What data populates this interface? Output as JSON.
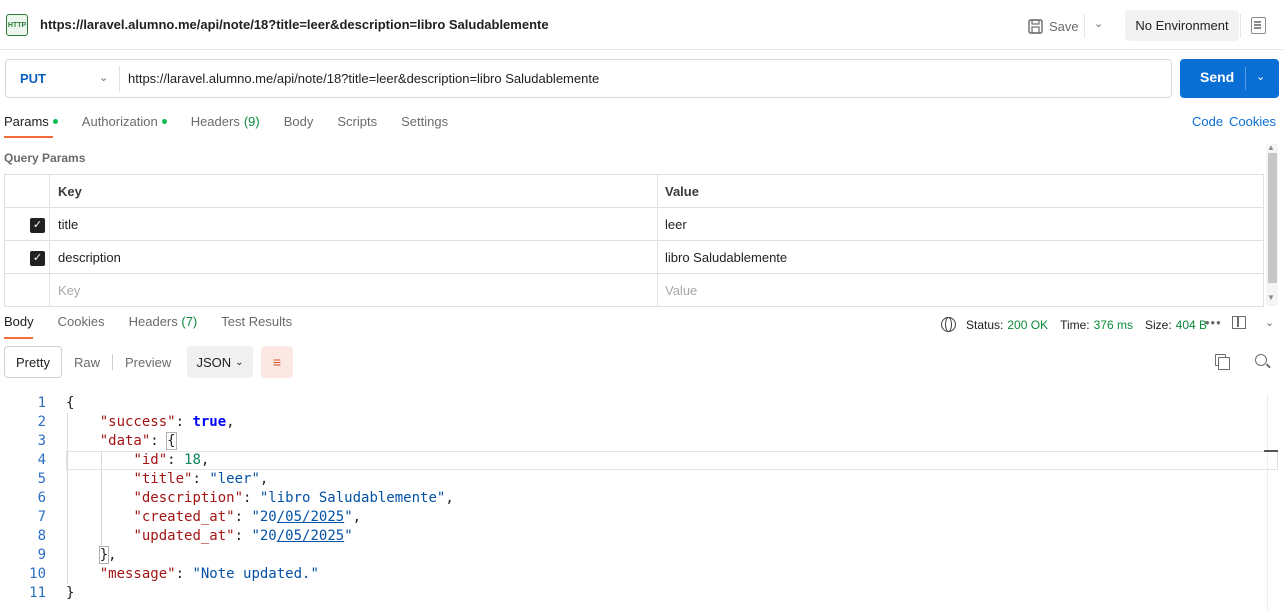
{
  "titlebar": {
    "icon_text": "HTTP",
    "title": "https://laravel.alumno.me/api/note/18?title=leer&description=libro Saludablemente",
    "save_label": "Save",
    "environment": "No Environment"
  },
  "request": {
    "method": "PUT",
    "url": "https://laravel.alumno.me/api/note/18?title=leer&description=libro Saludablemente",
    "send_label": "Send"
  },
  "request_tabs": {
    "params": "Params",
    "authorization": "Authorization",
    "headers": "Headers",
    "headers_count": "(9)",
    "body": "Body",
    "scripts": "Scripts",
    "settings": "Settings",
    "code_link": "Code",
    "cookies_link": "Cookies"
  },
  "query_params": {
    "title": "Query Params",
    "header_key": "Key",
    "header_value": "Value",
    "rows": [
      {
        "key": "title",
        "value": "leer",
        "checked": true
      },
      {
        "key": "description",
        "value": "libro Saludablemente",
        "checked": true
      }
    ],
    "placeholder_key": "Key",
    "placeholder_value": "Value"
  },
  "response_tabs": {
    "body": "Body",
    "cookies": "Cookies",
    "headers": "Headers",
    "headers_count": "(7)",
    "test_results": "Test Results"
  },
  "response_status": {
    "status_label": "Status:",
    "status_value": "200 OK",
    "time_label": "Time:",
    "time_value": "376 ms",
    "size_label": "Size:",
    "size_value": "404 B"
  },
  "response_toolbar": {
    "pretty": "Pretty",
    "raw": "Raw",
    "preview": "Preview",
    "format": "JSON"
  },
  "code": {
    "line_numbers": [
      "1",
      "2",
      "3",
      "4",
      "5",
      "6",
      "7",
      "8",
      "9",
      "10",
      "11"
    ],
    "success_key": "\"success\"",
    "success_value": "true",
    "data_key": "\"data\"",
    "id_key": "\"id\"",
    "id_value": "18",
    "title_key": "\"title\"",
    "title_value": "\"leer\"",
    "description_key": "\"description\"",
    "description_value": "\"libro Saludablemente\"",
    "created_key": "\"created_at\"",
    "created_value_a": "\"20",
    "created_value_b": "/05/2025",
    "created_value_c": "\"",
    "updated_key": "\"updated_at\"",
    "updated_value_a": "\"20",
    "updated_value_b": "/05/2025",
    "updated_value_c": "\"",
    "message_key": "\"message\"",
    "message_value": "\"Note updated.\""
  },
  "colors": {
    "accent": "#f26b3a",
    "send": "#0a6fd4",
    "status_ok": "#0a8a3a"
  }
}
